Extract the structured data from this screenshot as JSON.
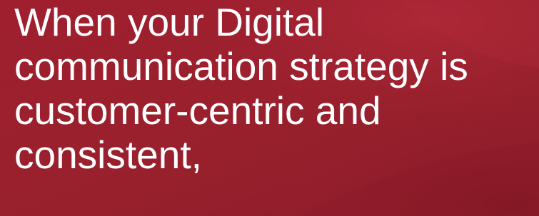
{
  "colors": {
    "background": "#9c1f2e",
    "text": "#ffffff"
  },
  "hero": {
    "lines": [
      "When your Digital",
      "communication strategy is",
      "customer-centric and",
      "consistent,"
    ]
  }
}
